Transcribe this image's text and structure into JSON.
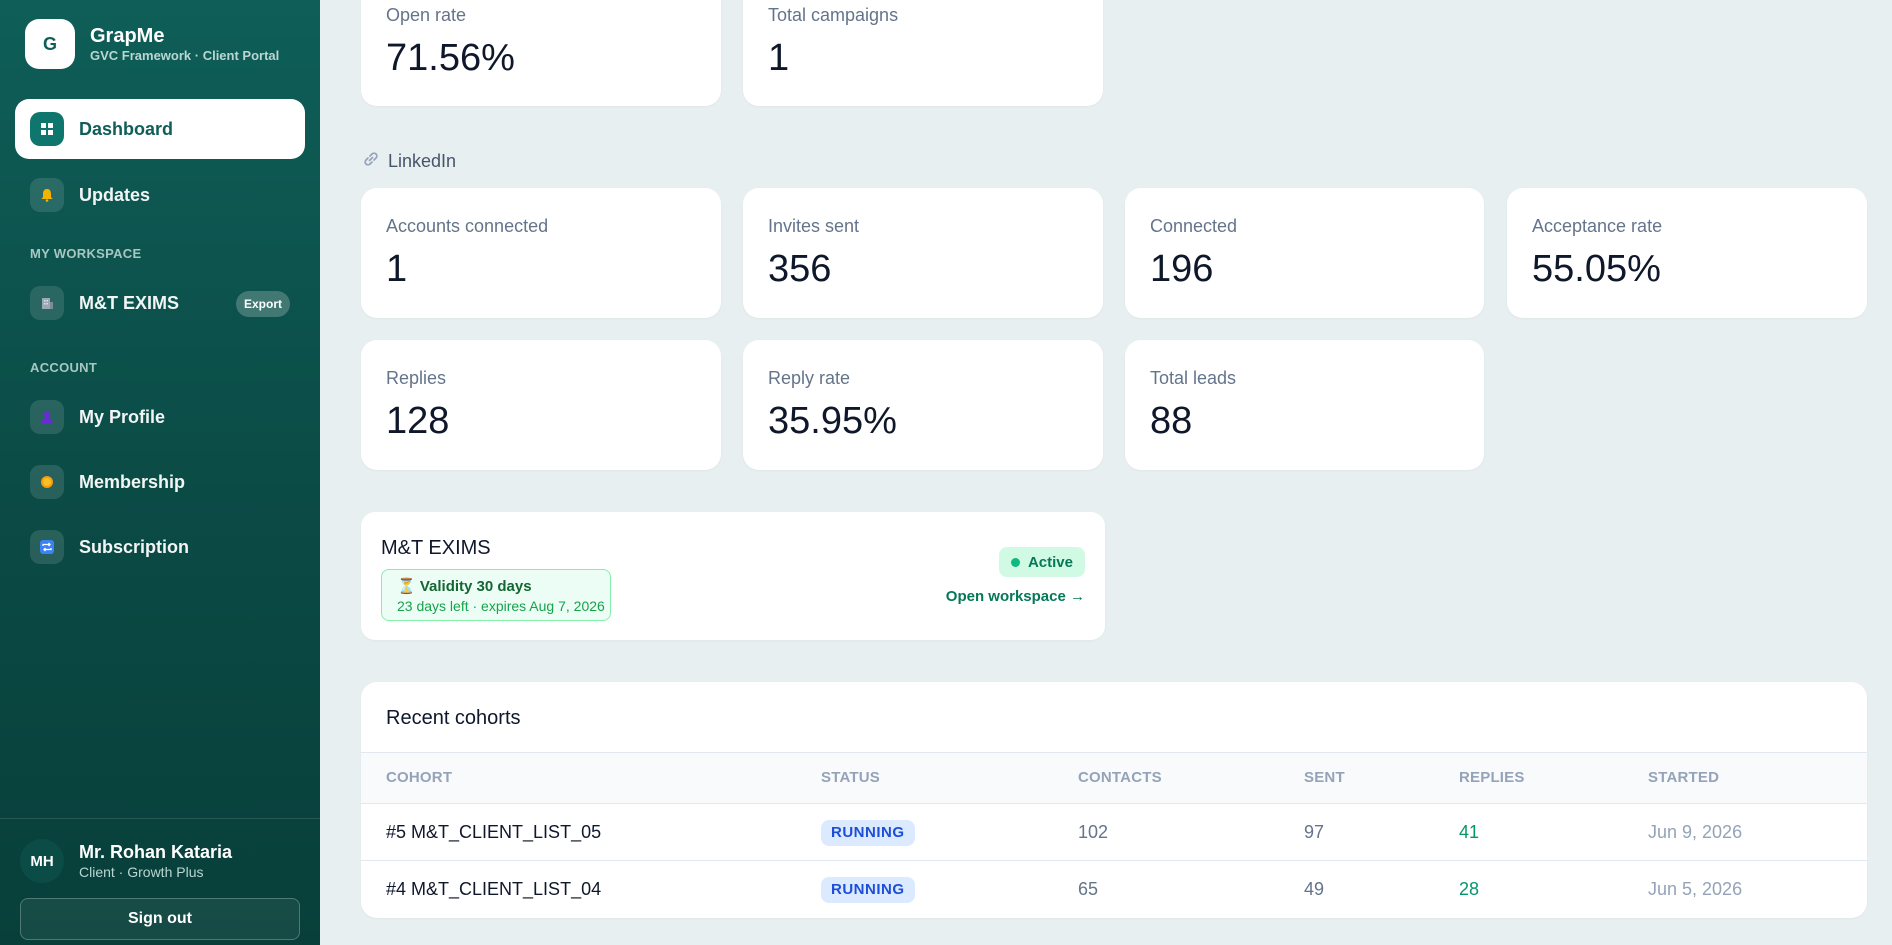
{
  "brand": {
    "logo_letter": "G",
    "name": "GrapMe",
    "subtitle": "GVC Framework · Client Portal"
  },
  "nav": {
    "dashboard": "Dashboard",
    "updates": "Updates",
    "workspace_section": "MY WORKSPACE",
    "workspace_item": "M&T EXIMS",
    "export_label": "Export",
    "account_section": "ACCOUNT",
    "profile": "My Profile",
    "membership": "Membership",
    "subscription": "Subscription"
  },
  "icons": {
    "dashboard": "grid-icon",
    "updates": "bell-icon",
    "workspace": "building-icon",
    "profile": "person-icon",
    "membership": "coin-icon",
    "subscription": "repeat-icon",
    "linkedin": "link-icon"
  },
  "user": {
    "initials": "MH",
    "name": "Mr. Rohan Kataria",
    "role": "Client · Growth Plus",
    "signout": "Sign out"
  },
  "email_stats": [
    {
      "label": "Open rate",
      "value": "71.56%"
    },
    {
      "label": "Total campaigns",
      "value": "1"
    }
  ],
  "linkedin": {
    "title": "LinkedIn",
    "stats": [
      {
        "label": "Accounts connected",
        "value": "1"
      },
      {
        "label": "Invites sent",
        "value": "356"
      },
      {
        "label": "Connected",
        "value": "196"
      },
      {
        "label": "Acceptance rate",
        "value": "55.05%"
      },
      {
        "label": "Replies",
        "value": "128"
      },
      {
        "label": "Reply rate",
        "value": "35.95%"
      },
      {
        "label": "Total leads",
        "value": "88"
      }
    ]
  },
  "workspace_card": {
    "title": "M&T EXIMS",
    "validity_title": "⏳ Validity 30 days",
    "validity_sub": "23 days left · expires Aug 7, 2026",
    "status": "Active",
    "open_link": "Open workspace →"
  },
  "cohorts": {
    "title": "Recent cohorts",
    "headers": [
      "COHORT",
      "STATUS",
      "CONTACTS",
      "SENT",
      "REPLIES",
      "STARTED"
    ],
    "rows": [
      {
        "cohort": "#5 M&T_CLIENT_LIST_05",
        "status": "RUNNING",
        "contacts": "102",
        "sent": "97",
        "replies": "41",
        "started": "Jun 9, 2026"
      },
      {
        "cohort": "#4 M&T_CLIENT_LIST_04",
        "status": "RUNNING",
        "contacts": "65",
        "sent": "49",
        "replies": "28",
        "started": "Jun 5, 2026"
      }
    ]
  },
  "colors": {
    "sidebar": "#0f5e58",
    "accent": "#0f766e",
    "background": "#e8eff1",
    "running": "#1d4ed8",
    "active": "#047857"
  }
}
